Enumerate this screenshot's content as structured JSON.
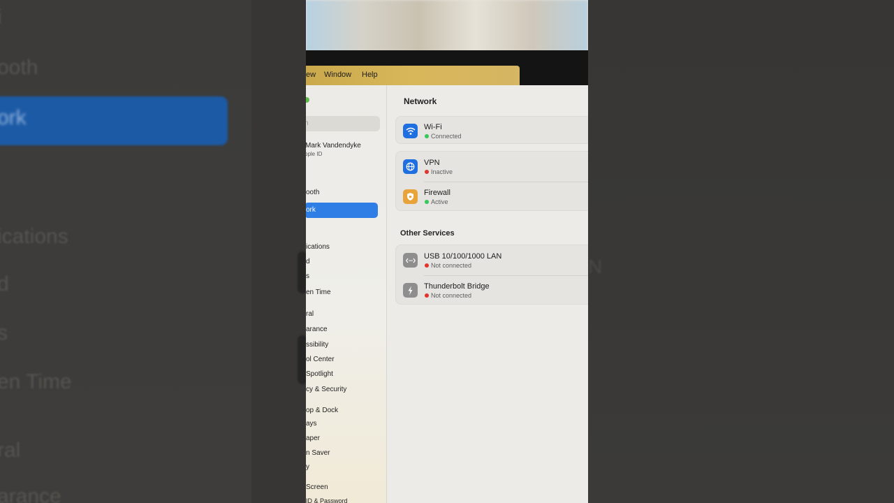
{
  "menubar": {
    "items": [
      "ew",
      "Window",
      "Help"
    ],
    "color": "#d6b45a"
  },
  "sidebar": {
    "search_placeholder": "h",
    "account": {
      "name": "Mark Vandendyke",
      "subtitle": "pple ID"
    },
    "items": [
      "ooth",
      "ork",
      "ications",
      "d",
      "s",
      "en Time",
      "ral",
      "arance",
      "ssibility",
      "ol Center",
      "Spotlight",
      "cy & Security",
      "op & Dock",
      "ays",
      "aper",
      "n Saver",
      "y",
      "Screen",
      "ID & Password"
    ],
    "selected_item": "ork",
    "selected_color": "#2f7ee6"
  },
  "network": {
    "title": "Network",
    "primary": [
      {
        "name": "Wi-Fi",
        "status": "Connected",
        "status_color": "#34c759",
        "icon": "wifi-icon",
        "icon_color": "#1f6fe0"
      },
      {
        "name": "VPN",
        "status": "Inactive",
        "status_color": "#e0342c",
        "icon": "globe-icon",
        "icon_color": "#1f6fe0"
      },
      {
        "name": "Firewall",
        "status": "Active",
        "status_color": "#34c759",
        "icon": "shield-icon",
        "icon_color": "#e8a33a"
      }
    ],
    "other_title": "Other Services",
    "other": [
      {
        "name": "USB 10/100/1000 LAN",
        "status": "Not connected",
        "status_color": "#e0342c",
        "icon": "ethernet-icon",
        "icon_color": "#8e8e8e"
      },
      {
        "name": "Thunderbolt Bridge",
        "status": "Not connected",
        "status_color": "#e0342c",
        "icon": "thunderbolt-icon",
        "icon_color": "#8e8e8e"
      }
    ]
  },
  "background_blur": {
    "left_items": [
      "i",
      "ooth",
      "ork",
      "ications",
      "d",
      "s",
      "en Time",
      "ral",
      "arance"
    ],
    "right_item": "N"
  }
}
